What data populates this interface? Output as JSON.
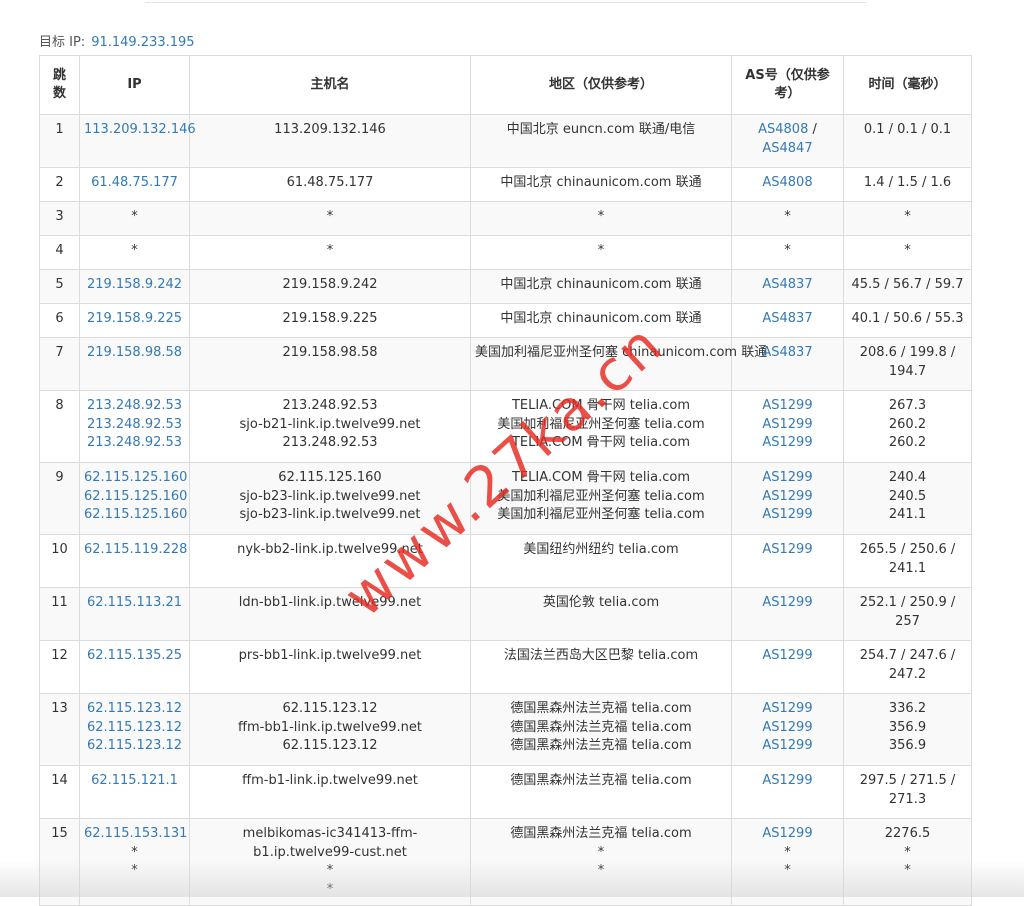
{
  "target": {
    "label": "目标 IP:",
    "ip": "91.149.233.195"
  },
  "headers": {
    "hop": "跳数",
    "ip": "IP",
    "host": "主机名",
    "region": "地区（仅供参考）",
    "as": "AS号（仅供参考）",
    "time": "时间（毫秒）"
  },
  "rows": [
    {
      "hop": "1",
      "ips": [
        "113.209.132.146"
      ],
      "hosts": [
        "113.209.132.146"
      ],
      "regions": [
        "中国北京 euncn.com 联通/电信"
      ],
      "as": [
        "AS4808",
        "AS4847"
      ],
      "time": [
        "0.1 / 0.1 / 0.1"
      ]
    },
    {
      "hop": "2",
      "ips": [
        "61.48.75.177"
      ],
      "hosts": [
        "61.48.75.177"
      ],
      "regions": [
        "中国北京 chinaunicom.com 联通"
      ],
      "as": [
        "AS4808"
      ],
      "time": [
        "1.4 / 1.5 / 1.6"
      ]
    },
    {
      "hop": "3",
      "ips": [
        "*"
      ],
      "hosts": [
        "*"
      ],
      "regions": [
        "*"
      ],
      "as": [
        "*"
      ],
      "time": [
        "*"
      ]
    },
    {
      "hop": "4",
      "ips": [
        "*"
      ],
      "hosts": [
        "*"
      ],
      "regions": [
        "*"
      ],
      "as": [
        "*"
      ],
      "time": [
        "*"
      ]
    },
    {
      "hop": "5",
      "ips": [
        "219.158.9.242"
      ],
      "hosts": [
        "219.158.9.242"
      ],
      "regions": [
        "中国北京 chinaunicom.com 联通"
      ],
      "as": [
        "AS4837"
      ],
      "time": [
        "45.5 / 56.7 / 59.7"
      ]
    },
    {
      "hop": "6",
      "ips": [
        "219.158.9.225"
      ],
      "hosts": [
        "219.158.9.225"
      ],
      "regions": [
        "中国北京 chinaunicom.com 联通"
      ],
      "as": [
        "AS4837"
      ],
      "time": [
        "40.1 / 50.6 / 55.3"
      ]
    },
    {
      "hop": "7",
      "ips": [
        "219.158.98.58"
      ],
      "hosts": [
        "219.158.98.58"
      ],
      "regions": [
        "美国加利福尼亚州圣何塞 chinaunicom.com 联通"
      ],
      "as": [
        "AS4837"
      ],
      "time": [
        "208.6 / 199.8 / 194.7"
      ]
    },
    {
      "hop": "8",
      "ips": [
        "213.248.92.53",
        "213.248.92.53",
        "213.248.92.53"
      ],
      "hosts": [
        "213.248.92.53",
        "sjo-b21-link.ip.twelve99.net",
        "213.248.92.53"
      ],
      "regions": [
        "TELIA.COM 骨干网 telia.com",
        "美国加利福尼亚州圣何塞 telia.com",
        "TELIA.COM 骨干网 telia.com"
      ],
      "as": [
        "AS1299",
        "AS1299",
        "AS1299"
      ],
      "time": [
        "267.3",
        "260.2",
        "260.2"
      ]
    },
    {
      "hop": "9",
      "ips": [
        "62.115.125.160",
        "62.115.125.160",
        "62.115.125.160"
      ],
      "hosts": [
        "62.115.125.160",
        "sjo-b23-link.ip.twelve99.net",
        "sjo-b23-link.ip.twelve99.net"
      ],
      "regions": [
        "TELIA.COM 骨干网 telia.com",
        "美国加利福尼亚州圣何塞 telia.com",
        "美国加利福尼亚州圣何塞 telia.com"
      ],
      "as": [
        "AS1299",
        "AS1299",
        "AS1299"
      ],
      "time": [
        "240.4",
        "240.5",
        "241.1"
      ]
    },
    {
      "hop": "10",
      "ips": [
        "62.115.119.228"
      ],
      "hosts": [
        "nyk-bb2-link.ip.twelve99.net"
      ],
      "regions": [
        "美国纽约州纽约 telia.com"
      ],
      "as": [
        "AS1299"
      ],
      "time": [
        "265.5 / 250.6 / 241.1"
      ]
    },
    {
      "hop": "11",
      "ips": [
        "62.115.113.21"
      ],
      "hosts": [
        "ldn-bb1-link.ip.twelve99.net"
      ],
      "regions": [
        "英国伦敦 telia.com"
      ],
      "as": [
        "AS1299"
      ],
      "time": [
        "252.1 / 250.9 / 257"
      ]
    },
    {
      "hop": "12",
      "ips": [
        "62.115.135.25"
      ],
      "hosts": [
        "prs-bb1-link.ip.twelve99.net"
      ],
      "regions": [
        "法国法兰西岛大区巴黎 telia.com"
      ],
      "as": [
        "AS1299"
      ],
      "time": [
        "254.7 / 247.6 / 247.2"
      ]
    },
    {
      "hop": "13",
      "ips": [
        "62.115.123.12",
        "62.115.123.12",
        "62.115.123.12"
      ],
      "hosts": [
        "62.115.123.12",
        "ffm-bb1-link.ip.twelve99.net",
        "62.115.123.12"
      ],
      "regions": [
        "德国黑森州法兰克福 telia.com",
        "德国黑森州法兰克福 telia.com",
        "德国黑森州法兰克福 telia.com"
      ],
      "as": [
        "AS1299",
        "AS1299",
        "AS1299"
      ],
      "time": [
        "336.2",
        "356.9",
        "356.9"
      ]
    },
    {
      "hop": "14",
      "ips": [
        "62.115.121.1"
      ],
      "hosts": [
        "ffm-b1-link.ip.twelve99.net"
      ],
      "regions": [
        "德国黑森州法兰克福 telia.com"
      ],
      "as": [
        "AS1299"
      ],
      "time": [
        "297.5 / 271.5 / 271.3"
      ]
    },
    {
      "hop": "15",
      "ips": [
        "62.115.153.131",
        "*",
        "*"
      ],
      "hosts": [
        "melbikomas-ic341413-ffm-b1.ip.twelve99-cust.net",
        "*",
        "*"
      ],
      "regions": [
        "德国黑森州法兰克福 telia.com",
        "*",
        "*"
      ],
      "as": [
        "AS1299",
        "*",
        "*"
      ],
      "time": [
        "2276.5",
        "*",
        "*"
      ]
    }
  ],
  "watermark": "www.27ka.cn",
  "colors": {
    "link": "#337ab7",
    "watermark": "#e6281e",
    "stripe": "#f9f9f9",
    "border": "#dcdcdc"
  }
}
